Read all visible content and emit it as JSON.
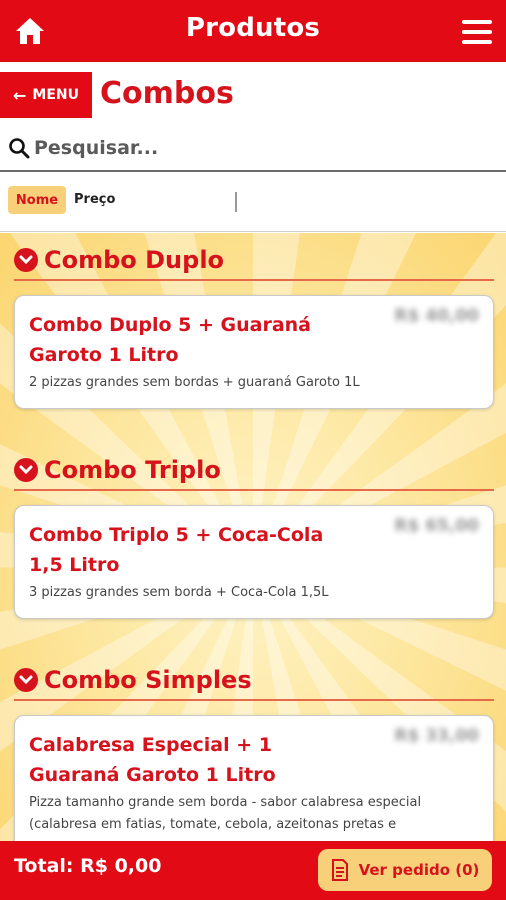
{
  "header": {
    "title": "Produtos"
  },
  "nav": {
    "back_label": "MENU",
    "section_title": "Combos"
  },
  "search": {
    "placeholder": "Pesquisar..."
  },
  "sort": {
    "name_label": "Nome",
    "price_label": "Preço"
  },
  "groups": [
    {
      "title": "Combo Duplo",
      "items": [
        {
          "name": "Combo Duplo 5 + Guaraná Garoto 1 Litro",
          "price": "R$ 40,00",
          "description": "2 pizzas grandes sem bordas + guaraná Garoto 1L"
        }
      ]
    },
    {
      "title": "Combo Triplo",
      "items": [
        {
          "name": "Combo Triplo 5 + Coca-Cola 1,5 Litro",
          "price": "R$ 65,00",
          "description": "3 pizzas grandes sem borda + Coca-Cola 1,5L"
        }
      ]
    },
    {
      "title": "Combo Simples",
      "items": [
        {
          "name": "Calabresa Especial + 1 Guaraná Garoto 1 Litro",
          "price": "R$ 33,00",
          "description": "Pizza tamanho grande sem borda - sabor calabresa especial (calabresa em fatias, tomate, cebola, azeitonas pretas e"
        }
      ]
    }
  ],
  "footer": {
    "total": "Total: R$ 0,00",
    "order_button": "Ver pedido (0)"
  },
  "colors": {
    "primary": "#e20a14",
    "accent": "#f8d07a",
    "title_red": "#d6121c"
  },
  "icons": {
    "home": "home-icon",
    "menu": "hamburger-menu-icon",
    "search": "search-icon",
    "back": "arrow-left-icon",
    "chevron": "chevron-down-icon",
    "receipt": "receipt-icon"
  }
}
